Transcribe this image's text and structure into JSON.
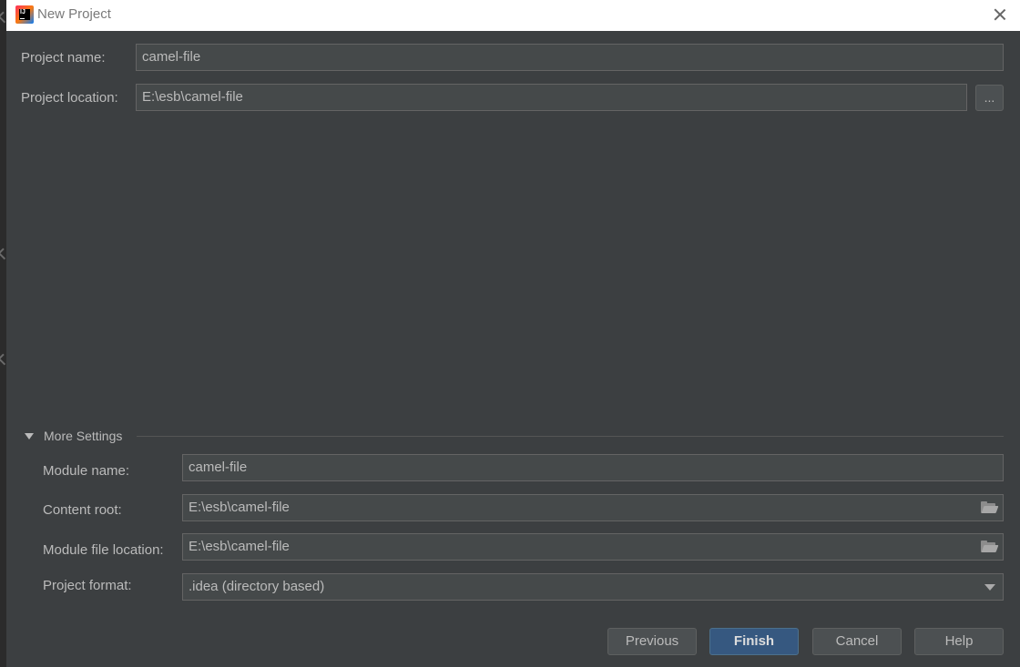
{
  "window": {
    "title": "New Project"
  },
  "project": {
    "name_label": "Project name:",
    "name_value": "camel-file",
    "location_label": "Project location:",
    "location_value": "E:\\esb\\camel-file",
    "browse_label": "..."
  },
  "more_settings": {
    "title": "More Settings",
    "module_name_label": "Module name:",
    "module_name_value": "camel-file",
    "content_root_label": "Content root:",
    "content_root_value": "E:\\esb\\camel-file",
    "module_file_location_label": "Module file location:",
    "module_file_location_value": "E:\\esb\\camel-file",
    "project_format_label": "Project format:",
    "project_format_value": ".idea (directory based)"
  },
  "buttons": {
    "previous": "Previous",
    "finish": "Finish",
    "cancel": "Cancel",
    "help": "Help"
  }
}
